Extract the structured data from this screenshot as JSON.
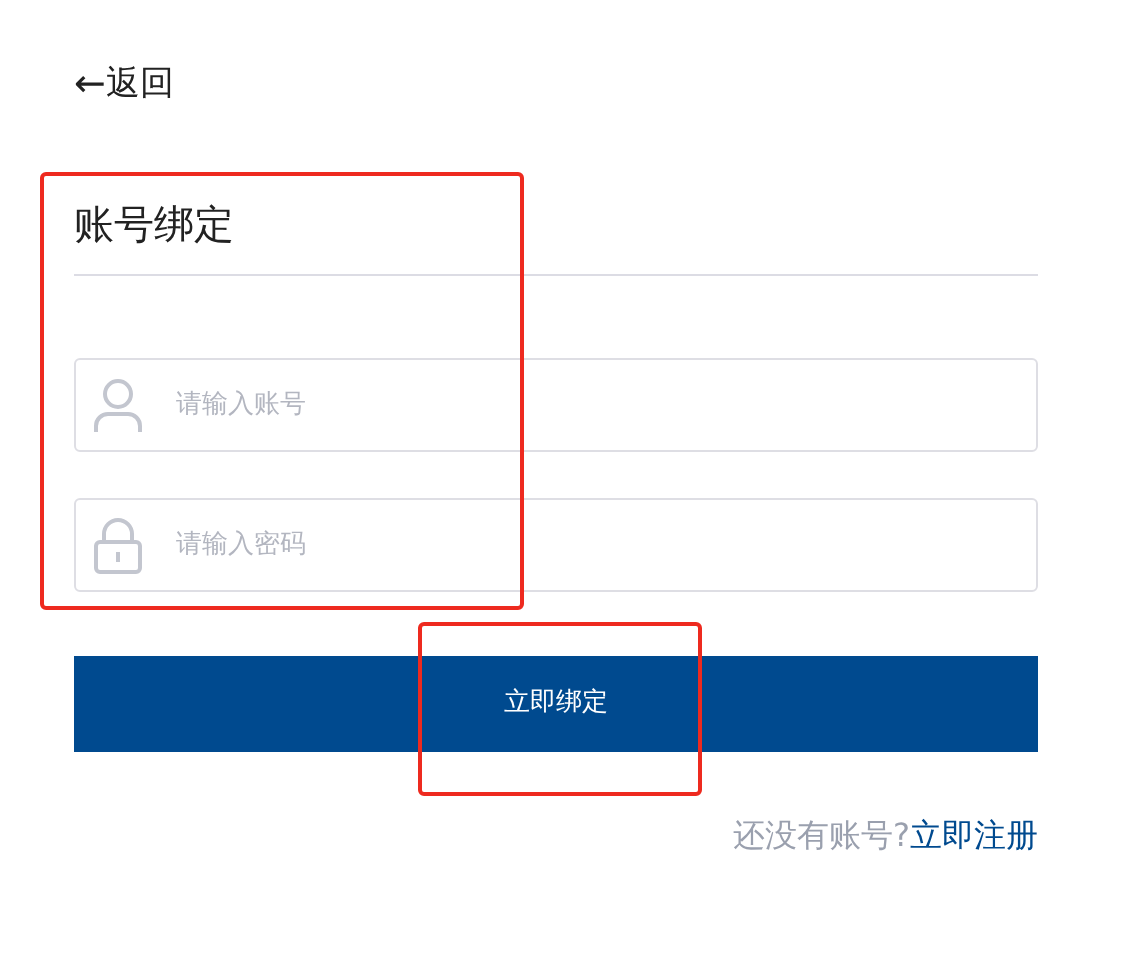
{
  "back_link": {
    "icon": "←",
    "label": "返回"
  },
  "title": "账号绑定",
  "fields": [
    {
      "kind": "user",
      "placeholder": "请输入账号"
    },
    {
      "kind": "password",
      "placeholder": "请输入密码"
    }
  ],
  "submit_button": "立即绑定",
  "register_prompt": {
    "text": "还没有账号?",
    "link": "立即注册"
  },
  "annotation_frames": [
    {
      "kind": "frame",
      "color": "#ee2a1f"
    },
    {
      "kind": "frame",
      "color": "#ee2a1f"
    }
  ]
}
